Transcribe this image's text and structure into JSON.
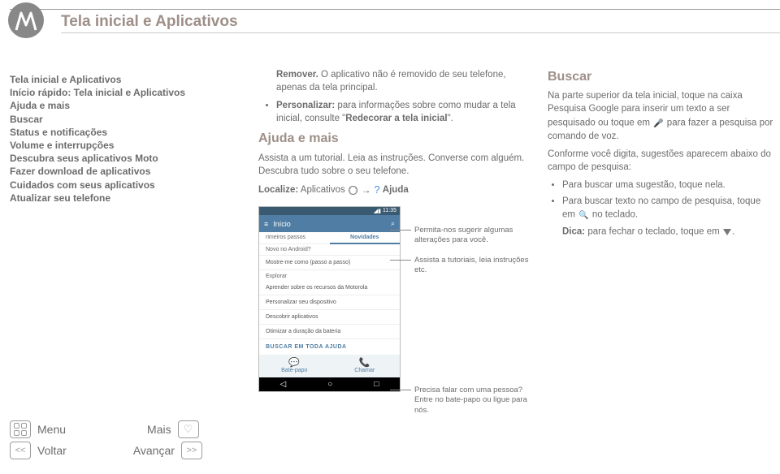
{
  "header": {
    "title": "Tela inicial e Aplicativos"
  },
  "leftnav": {
    "items": [
      {
        "label": "Tela inicial e Aplicativos"
      },
      {
        "label": "Início rápido: Tela inicial e Aplicativos"
      },
      {
        "label": "Ajuda e mais"
      },
      {
        "label": "Buscar"
      },
      {
        "label": "Status e notificações"
      },
      {
        "label": "Volume e interrupções"
      },
      {
        "label": "Descubra seus aplicativos Moto"
      },
      {
        "label": "Fazer download de aplicativos"
      },
      {
        "label": "Cuidados com seus aplicativos"
      },
      {
        "label": "Atualizar seu telefone"
      }
    ]
  },
  "bottombar": {
    "menu": "Menu",
    "mais": "Mais",
    "voltar": "Voltar",
    "avancar": "Avançar",
    "back_sym": "<<",
    "fwd_sym": ">>"
  },
  "mid": {
    "p1_bold": "Remover.",
    "p1_rest": " O aplicativo não é removido de seu telefone, apenas da tela principal.",
    "bullet_bold": "Personalizar:",
    "bullet_rest_a": " para informações sobre como mudar a tela inicial, consulte \"",
    "bullet_link": "Redecorar a tela inicial",
    "bullet_rest_b": "\".",
    "h2": "Ajuda e mais",
    "p2": "Assista a um tutorial. Leia as instruções. Converse com alguém. Descubra tudo sobre o seu telefone.",
    "localize_label": "Localize:",
    "localize_text": " Aplicativos ",
    "localize_end": "Ajuda"
  },
  "phone": {
    "time": "11:35",
    "header": "Início",
    "subs": [
      "rimeiros passos",
      "Novidades",
      "Novo no Android?"
    ],
    "walk": "Mostre-me como (passo a passo)",
    "section": "Explorar",
    "items": [
      "Aprender sobre os recursos da Motorola",
      "Personalizar seu dispositivo",
      "Descobrir aplicativos",
      "Otimizar a duração da bateria"
    ],
    "search_all": "BUSCAR EM TODA AJUDA",
    "tab1": "Bate-papo",
    "tab2": "Chamar"
  },
  "callouts": {
    "c1": "Permita-nos sugerir algumas alterações para você.",
    "c2": "Assista a tutoriais, leia instruções etc.",
    "c3": "Precisa falar com uma pessoa? Entre no bate-papo ou ligue para nós."
  },
  "right": {
    "h": "Buscar",
    "p1a": "Na parte superior da tela inicial, toque na caixa Pesquisa Google para inserir um texto a ser pesquisado ou toque em ",
    "p1b": " para fazer a pesquisa por comando de voz.",
    "p2": "Conforme você digita, sugestões aparecem abaixo do campo de pesquisa:",
    "li1": "Para buscar uma sugestão, toque nela.",
    "li2a": "Para buscar texto no campo de pesquisa, toque em ",
    "li2b": " no teclado.",
    "dica_b": "Dica:",
    "dica_rest": " para fechar o teclado, toque em "
  }
}
